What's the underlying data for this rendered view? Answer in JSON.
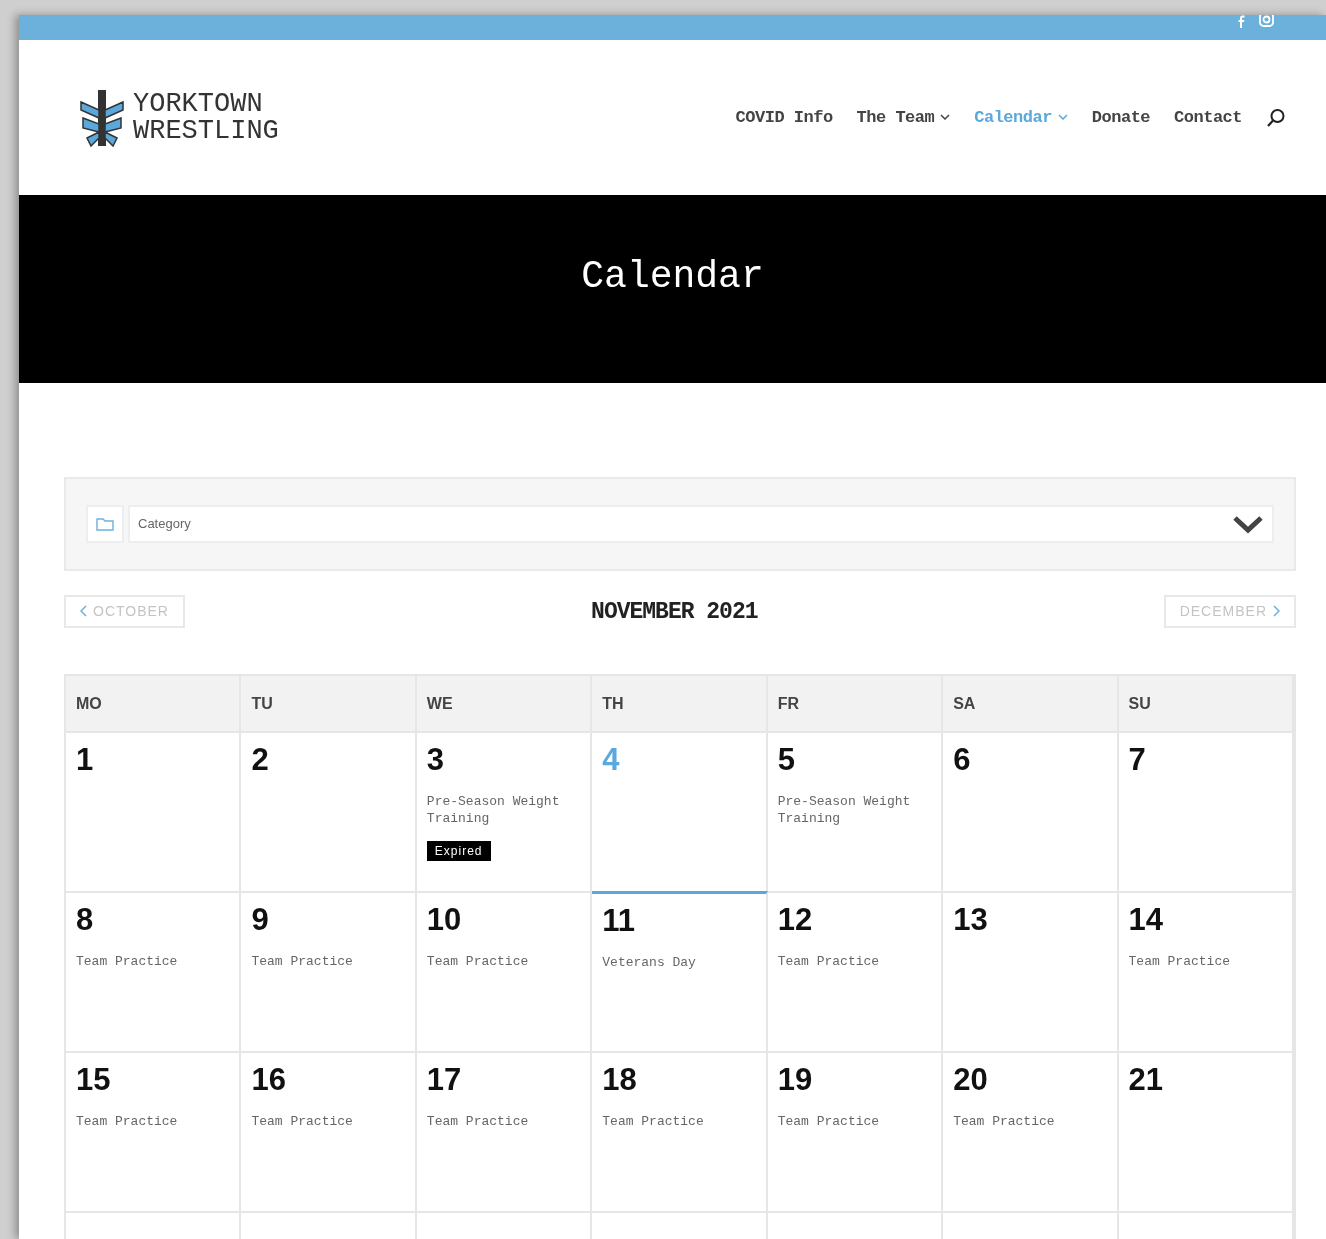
{
  "header": {
    "logo_lines": [
      "YORKTOWN",
      "WRESTLING"
    ],
    "nav": [
      {
        "label": "COVID Info",
        "selected": false,
        "dropdown": false
      },
      {
        "label": "The Team",
        "selected": false,
        "dropdown": true
      },
      {
        "label": "Calendar",
        "selected": true,
        "dropdown": true
      },
      {
        "label": "Donate",
        "selected": false,
        "dropdown": false
      },
      {
        "label": "Contact",
        "selected": false,
        "dropdown": false
      }
    ]
  },
  "banner": {
    "title": "Calendar"
  },
  "filter": {
    "placeholder": "Category"
  },
  "month_nav": {
    "previous": "OCTOBER",
    "title": "NOVEMBER 2021",
    "next": "DECEMBER"
  },
  "calendar": {
    "weekdays": [
      "MO",
      "TU",
      "WE",
      "TH",
      "FR",
      "SA",
      "SU"
    ],
    "weeks": [
      [
        {
          "day": "1",
          "today": false
        },
        {
          "day": "2",
          "today": false
        },
        {
          "day": "3",
          "today": false,
          "events": [
            {
              "title": "Pre-Season Weight Training",
              "badge": "Expired"
            }
          ]
        },
        {
          "day": "4",
          "today": true
        },
        {
          "day": "5",
          "today": false,
          "events": [
            {
              "title": "Pre-Season Weight Training"
            }
          ]
        },
        {
          "day": "6",
          "today": false
        },
        {
          "day": "7",
          "today": false
        }
      ],
      [
        {
          "day": "8",
          "today": false,
          "events": [
            {
              "title": "Team Practice"
            }
          ]
        },
        {
          "day": "9",
          "today": false,
          "events": [
            {
              "title": "Team Practice"
            }
          ]
        },
        {
          "day": "10",
          "today": false,
          "events": [
            {
              "title": "Team Practice"
            }
          ]
        },
        {
          "day": "11",
          "today": false,
          "events": [
            {
              "title": "Veterans Day"
            }
          ]
        },
        {
          "day": "12",
          "today": false,
          "events": [
            {
              "title": "Team Practice"
            }
          ]
        },
        {
          "day": "13",
          "today": false
        },
        {
          "day": "14",
          "today": false,
          "events": [
            {
              "title": "Team Practice"
            }
          ]
        }
      ],
      [
        {
          "day": "15",
          "today": false,
          "events": [
            {
              "title": "Team Practice"
            }
          ]
        },
        {
          "day": "16",
          "today": false,
          "events": [
            {
              "title": "Team Practice"
            }
          ]
        },
        {
          "day": "17",
          "today": false,
          "events": [
            {
              "title": "Team Practice"
            }
          ]
        },
        {
          "day": "18",
          "today": false,
          "events": [
            {
              "title": "Team Practice"
            }
          ]
        },
        {
          "day": "19",
          "today": false,
          "events": [
            {
              "title": "Team Practice"
            }
          ]
        },
        {
          "day": "20",
          "today": false,
          "events": [
            {
              "title": "Team Practice"
            }
          ]
        },
        {
          "day": "21",
          "today": false
        }
      ]
    ]
  }
}
